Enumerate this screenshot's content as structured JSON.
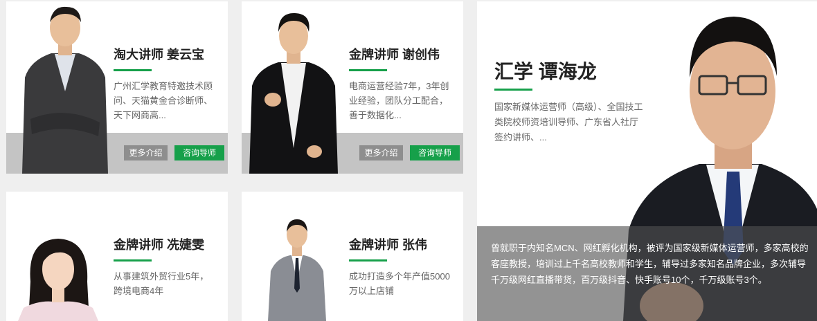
{
  "lecturers": [
    {
      "name": "淘大讲师 姜云宝",
      "desc": "广州汇学教育特邀技术顾问、天猫黄金合诊断师、天下网商高...",
      "more_label": "更多介绍",
      "consult_label": "咨询导师"
    },
    {
      "name": "金牌讲师 谢创伟",
      "desc": "电商运营经验7年，3年创业经验，团队分工配合，善于数据化...",
      "more_label": "更多介绍",
      "consult_label": "咨询导师"
    },
    {
      "name": "金牌讲师 冼婕雯",
      "desc": "从事建筑外贸行业5年，跨境电商4年"
    },
    {
      "name": "金牌讲师 张伟",
      "desc": "成功打造多个年产值5000万以上店铺"
    }
  ],
  "featured": {
    "name": "汇学 谭海龙",
    "desc": "国家新媒体运营师（高级）、全国技工类院校师资培训导师、广东省人社厅签约讲师、...",
    "overlay_text": "曾就职于内知名MCN、网红孵化机构，被评为国家级新媒体运营师，多家高校的客座教授，培训过上千名高校教师和学生，辅导过多家知名品牌企业，多次辅导千万级网红直播带货，百万级抖音、快手账号10个，千万级账号3个。"
  },
  "colors": {
    "accent": "#16a04a",
    "button_grey": "#8e8e8e",
    "band": "#c4c4c4"
  }
}
